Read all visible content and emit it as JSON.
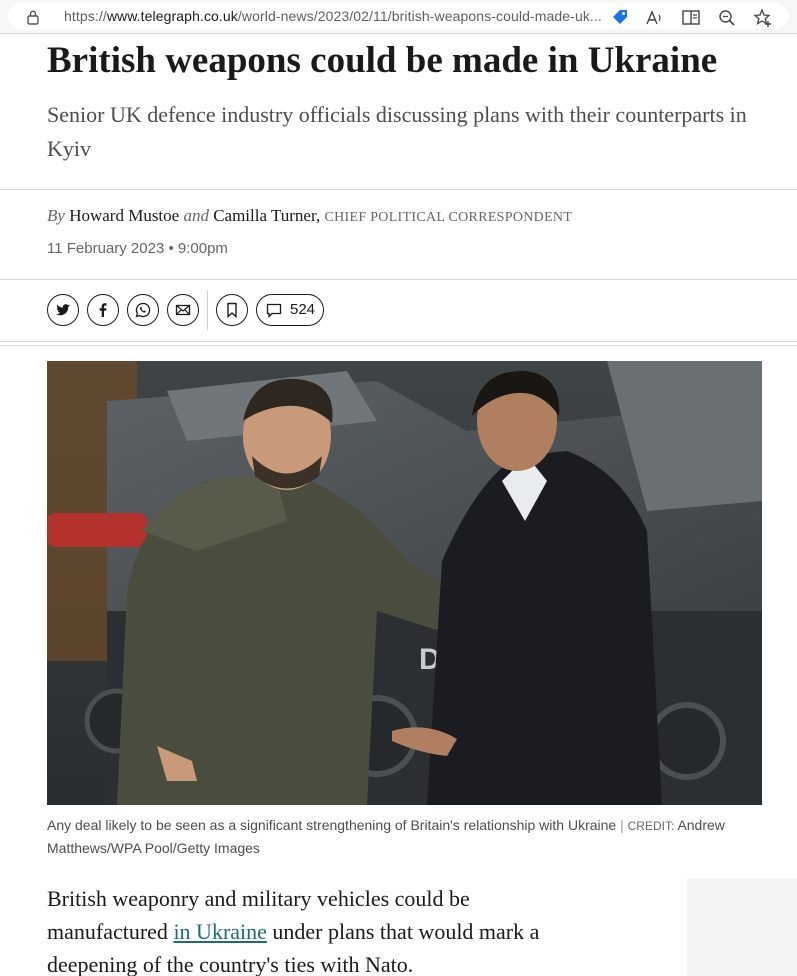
{
  "browser": {
    "url_prefix": "https://",
    "url_host": "www.telegraph.co.uk",
    "url_path": "/world-news/2023/02/11/british-weapons-could-made-uk..."
  },
  "article": {
    "headline": "British weapons could be made in Ukraine",
    "standfirst": "Senior UK defence industry officials discussing plans with their counterparts in Kyiv",
    "byline": {
      "by": "By",
      "author1": "Howard Mustoe",
      "and": "and",
      "author2": "Camilla Turner,",
      "role": "Chief Political Correspondent"
    },
    "date": "11 February 2023 • 9:00pm",
    "comment_count": "524",
    "photo": {
      "plate_text": "DR 8"
    },
    "caption": {
      "text": "Any deal likely to be seen as a significant strengthening of Britain's relationship with Ukraine",
      "separator": "|",
      "credit_label": "Credit:",
      "credit": "Andrew Matthews/WPA Pool/Getty Images"
    },
    "body": {
      "before_link": "British weaponry and military vehicles could be manufactured ",
      "link": "in Ukraine",
      "after_link": " under plans that would mark a deepening of the country's ties with Nato."
    }
  }
}
